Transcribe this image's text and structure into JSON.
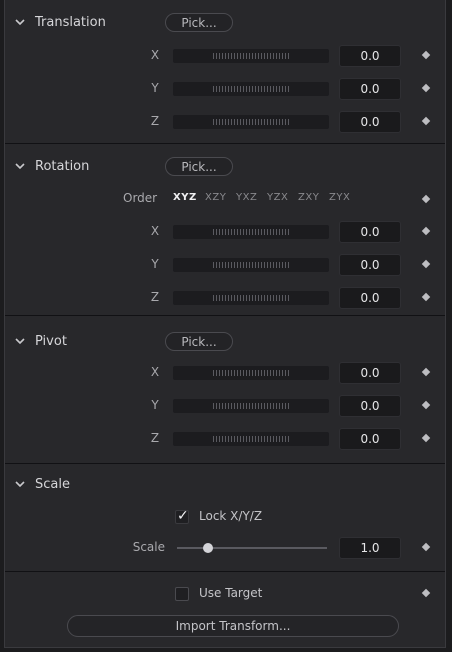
{
  "translation": {
    "title": "Translation",
    "pick_label": "Pick...",
    "rows": [
      {
        "axis": "X",
        "value": "0.0"
      },
      {
        "axis": "Y",
        "value": "0.0"
      },
      {
        "axis": "Z",
        "value": "0.0"
      }
    ]
  },
  "rotation": {
    "title": "Rotation",
    "pick_label": "Pick...",
    "order_label": "Order",
    "order_options": [
      "XYZ",
      "XZY",
      "YXZ",
      "YZX",
      "ZXY",
      "ZYX"
    ],
    "order_selected": "XYZ",
    "rows": [
      {
        "axis": "X",
        "value": "0.0"
      },
      {
        "axis": "Y",
        "value": "0.0"
      },
      {
        "axis": "Z",
        "value": "0.0"
      }
    ]
  },
  "pivot": {
    "title": "Pivot",
    "pick_label": "Pick...",
    "rows": [
      {
        "axis": "X",
        "value": "0.0"
      },
      {
        "axis": "Y",
        "value": "0.0"
      },
      {
        "axis": "Z",
        "value": "0.0"
      }
    ]
  },
  "scale": {
    "title": "Scale",
    "lock_label": "Lock X/Y/Z",
    "lock_checked": true,
    "scale_label": "Scale",
    "scale_value": "1.0"
  },
  "target": {
    "use_target_label": "Use Target",
    "use_target_checked": false,
    "import_label": "Import Transform..."
  },
  "icons": {
    "section_toggle": "chevron-down-icon",
    "keyframe": "diamond-keyframe-icon",
    "check": "checkmark-icon"
  }
}
